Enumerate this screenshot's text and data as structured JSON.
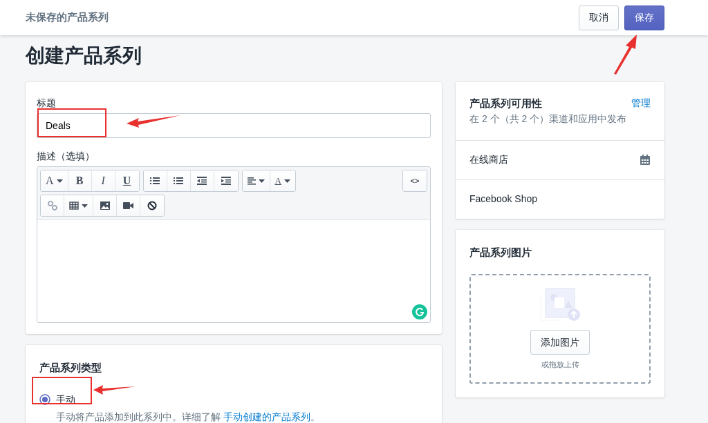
{
  "header": {
    "title": "未保存的产品系列",
    "buttons": [
      {
        "label": "取消",
        "kind": "secondary"
      },
      {
        "label": "保存",
        "kind": "primary"
      }
    ]
  },
  "page_title": "创建产品系列",
  "form": {
    "title_label": "标题",
    "title_value": "Deals",
    "description_label": "描述（选填）",
    "toolbar": [
      {
        "groups": [
          [
            {
              "kind": "font",
              "label": "A",
              "dropdown": true
            },
            {
              "kind": "bold",
              "label": "B"
            },
            {
              "kind": "italic",
              "label": "I"
            },
            {
              "kind": "underline",
              "label": "U"
            }
          ],
          [
            {
              "kind": "bullet-list"
            },
            {
              "kind": "numbered-list"
            },
            {
              "kind": "outdent"
            },
            {
              "kind": "indent"
            }
          ],
          [
            {
              "kind": "align",
              "dropdown": true
            },
            {
              "kind": "color",
              "label": "A",
              "dropdown": true
            }
          ]
        ],
        "end": [
          {
            "kind": "code",
            "label": "<>"
          }
        ]
      },
      {
        "groups": [
          [
            {
              "kind": "link"
            },
            {
              "kind": "table",
              "dropdown": true
            },
            {
              "kind": "image"
            },
            {
              "kind": "video"
            },
            {
              "kind": "clear"
            }
          ]
        ]
      }
    ]
  },
  "collection_type": {
    "title": "产品系列类型",
    "options": [
      {
        "label": "手动",
        "selected": true,
        "help": "手动将产品添加到此系列中。详细了解 ",
        "link": "手动创建的产品系列",
        "help_end": "。"
      }
    ]
  },
  "availability": {
    "title": "产品系列可用性",
    "action": "管理",
    "summary": "在 2 个（共 2 个）渠道和应用中发布",
    "channels": [
      {
        "name": "在线商店",
        "schedule_icon": true
      },
      {
        "name": "Facebook Shop",
        "schedule_icon": false
      }
    ]
  },
  "image_card": {
    "title": "产品系列图片",
    "button": "添加图片",
    "hint": "或拖放上传"
  }
}
